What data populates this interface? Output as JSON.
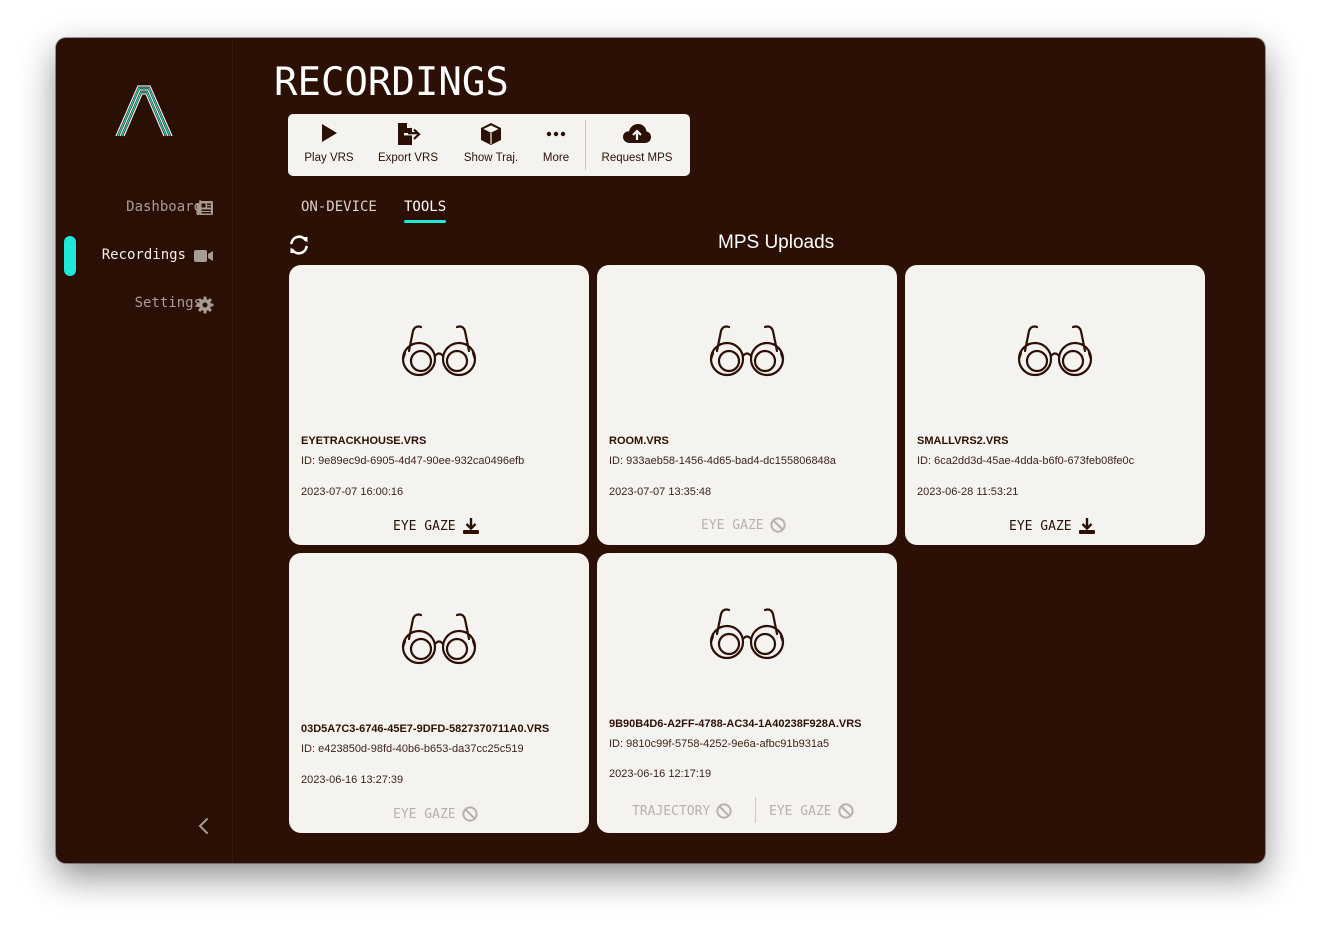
{
  "app": {
    "title": "RECORDINGS"
  },
  "sidebar": {
    "items": [
      {
        "label": "Dashboard",
        "icon": "newspaper-icon"
      },
      {
        "label": "Recordings",
        "icon": "video-camera-icon",
        "active": true
      },
      {
        "label": "Settings",
        "icon": "gear-icon"
      }
    ]
  },
  "toolbar": {
    "play": "Play VRS",
    "export": "Export VRS",
    "show_traj": "Show Traj.",
    "more": "More",
    "request_mps": "Request MPS"
  },
  "tabs": [
    {
      "label": "ON-DEVICE",
      "active": false
    },
    {
      "label": "TOOLS",
      "active": true
    }
  ],
  "section": {
    "title": "MPS Uploads"
  },
  "cards": [
    {
      "name": "EYETRACKHOUSE.VRS",
      "id": "ID: 9e89ec9d-6905-4d47-90ee-932ca0496efb",
      "date": "2023-07-07 16:00:16",
      "actions": [
        {
          "label": "EYE GAZE",
          "state": "download"
        }
      ]
    },
    {
      "name": "ROOM.VRS",
      "id": "ID: 933aeb58-1456-4d65-bad4-dc155806848a",
      "date": "2023-07-07 13:35:48",
      "actions": [
        {
          "label": "EYE GAZE",
          "state": "unavailable"
        }
      ]
    },
    {
      "name": "SMALLVRS2.VRS",
      "id": "ID: 6ca2dd3d-45ae-4dda-b6f0-673feb08fe0c",
      "date": "2023-06-28 11:53:21",
      "actions": [
        {
          "label": "EYE GAZE",
          "state": "download"
        }
      ]
    },
    {
      "name": "03D5A7C3-6746-45E7-9DFD-5827370711A0.VRS",
      "id": "ID: e423850d-98fd-40b6-b653-da37cc25c519",
      "date": "2023-06-16 13:27:39",
      "actions": [
        {
          "label": "EYE GAZE",
          "state": "unavailable"
        }
      ]
    },
    {
      "name": "9B90B4D6-A2FF-4788-AC34-1A40238F928A.VRS",
      "id": "ID: 9810c99f-5758-4252-9e6a-afbc91b931a5",
      "date": "2023-06-16 12:17:19",
      "actions": [
        {
          "label": "TRAJECTORY",
          "state": "unavailable"
        },
        {
          "label": "EYE GAZE",
          "state": "unavailable"
        }
      ]
    }
  ],
  "colors": {
    "background": "#2c1005",
    "accent": "#1de9d6",
    "card": "#f5f3ef",
    "disabled": "#b9b1ab"
  }
}
